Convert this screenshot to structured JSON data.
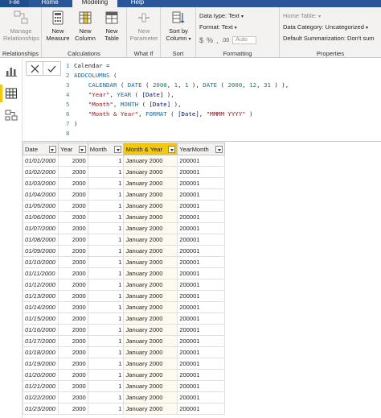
{
  "menu": {
    "tabs": [
      "File",
      "Home",
      "Modeling",
      "Help"
    ]
  },
  "ribbon": {
    "groups": {
      "relationships": {
        "title": "Relationships",
        "buttons": [
          {
            "label": "Manage\nRelationships",
            "icon": "manage-relationships-icon"
          }
        ]
      },
      "calculations": {
        "title": "Calculations",
        "buttons": [
          {
            "label": "New\nMeasure",
            "icon": "calculator-icon"
          },
          {
            "label": "New\nColumn",
            "icon": "new-column-icon"
          },
          {
            "label": "New\nTable",
            "icon": "new-table-icon"
          }
        ]
      },
      "whatif": {
        "title": "What If",
        "buttons": [
          {
            "label": "New\nParameter",
            "icon": "new-parameter-icon"
          }
        ]
      },
      "sort": {
        "title": "Sort",
        "buttons": [
          {
            "label": "Sort by\nColumn",
            "icon": "sort-by-column-icon"
          }
        ]
      },
      "formatting": {
        "title": "Formatting",
        "data_type": "Data type: Text",
        "format": "Format: Text",
        "currency_symbol": "$",
        "percent_symbol": "%",
        "comma_symbol": ",",
        "decimal_symbol": ".00",
        "auto_value": "Auto"
      },
      "properties": {
        "title": "Properties",
        "home_table": "Home Table:",
        "data_category": "Data Category: Uncategorized",
        "default_summarization": "Default Summarization: Don't sum"
      }
    }
  },
  "formula_bar": {
    "lines": [
      {
        "n": "1",
        "tokens": [
          {
            "t": "Calendar ="
          }
        ]
      },
      {
        "n": "2",
        "tokens": [
          {
            "t": "ADDCOLUMNS",
            "c": "kw"
          },
          {
            "t": " ("
          }
        ]
      },
      {
        "n": "3",
        "tokens": [
          {
            "t": "    "
          },
          {
            "t": "CALENDAR",
            "c": "kw"
          },
          {
            "t": " ( "
          },
          {
            "t": "DATE",
            "c": "kw"
          },
          {
            "t": " ( "
          },
          {
            "t": "2000",
            "c": "num"
          },
          {
            "t": ", "
          },
          {
            "t": "1",
            "c": "num"
          },
          {
            "t": ", "
          },
          {
            "t": "1",
            "c": "num"
          },
          {
            "t": " ), "
          },
          {
            "t": "DATE",
            "c": "kw"
          },
          {
            "t": " ( "
          },
          {
            "t": "2000",
            "c": "num"
          },
          {
            "t": ", "
          },
          {
            "t": "12",
            "c": "num"
          },
          {
            "t": ", "
          },
          {
            "t": "31",
            "c": "num"
          },
          {
            "t": " ) ),"
          }
        ]
      },
      {
        "n": "4",
        "tokens": [
          {
            "t": "    "
          },
          {
            "t": "\"Year\"",
            "c": "str"
          },
          {
            "t": ", "
          },
          {
            "t": "YEAR",
            "c": "kw"
          },
          {
            "t": " ( "
          },
          {
            "t": "[Date]",
            "c": "col"
          },
          {
            "t": " ),"
          }
        ]
      },
      {
        "n": "5",
        "tokens": [
          {
            "t": "    "
          },
          {
            "t": "\"Month\"",
            "c": "str"
          },
          {
            "t": ", "
          },
          {
            "t": "MONTH",
            "c": "kw"
          },
          {
            "t": " ( "
          },
          {
            "t": "[Date]",
            "c": "col"
          },
          {
            "t": " ),"
          }
        ]
      },
      {
        "n": "6",
        "tokens": [
          {
            "t": "    "
          },
          {
            "t": "\"Month & Year\"",
            "c": "str"
          },
          {
            "t": ", "
          },
          {
            "t": "FORMAT",
            "c": "kw"
          },
          {
            "t": " ( "
          },
          {
            "t": "[Date]",
            "c": "col"
          },
          {
            "t": ", "
          },
          {
            "t": "\"MMMM YYYY\"",
            "c": "str"
          },
          {
            "t": " )"
          }
        ]
      },
      {
        "n": "7",
        "tokens": [
          {
            "t": ")"
          }
        ]
      },
      {
        "n": "8",
        "tokens": []
      }
    ]
  },
  "table": {
    "columns": [
      "Date",
      "Year",
      "Month",
      "Month & Year",
      "YearMonth"
    ],
    "selected_column": "Month & Year",
    "rows": [
      [
        "01/01/2000",
        "2000",
        "1",
        "January 2000",
        "200001"
      ],
      [
        "01/02/2000",
        "2000",
        "1",
        "January 2000",
        "200001"
      ],
      [
        "01/03/2000",
        "2000",
        "1",
        "January 2000",
        "200001"
      ],
      [
        "01/04/2000",
        "2000",
        "1",
        "January 2000",
        "200001"
      ],
      [
        "01/05/2000",
        "2000",
        "1",
        "January 2000",
        "200001"
      ],
      [
        "01/06/2000",
        "2000",
        "1",
        "January 2000",
        "200001"
      ],
      [
        "01/07/2000",
        "2000",
        "1",
        "January 2000",
        "200001"
      ],
      [
        "01/08/2000",
        "2000",
        "1",
        "January 2000",
        "200001"
      ],
      [
        "01/09/2000",
        "2000",
        "1",
        "January 2000",
        "200001"
      ],
      [
        "01/10/2000",
        "2000",
        "1",
        "January 2000",
        "200001"
      ],
      [
        "01/11/2000",
        "2000",
        "1",
        "January 2000",
        "200001"
      ],
      [
        "01/12/2000",
        "2000",
        "1",
        "January 2000",
        "200001"
      ],
      [
        "01/13/2000",
        "2000",
        "1",
        "January 2000",
        "200001"
      ],
      [
        "01/14/2000",
        "2000",
        "1",
        "January 2000",
        "200001"
      ],
      [
        "01/15/2000",
        "2000",
        "1",
        "January 2000",
        "200001"
      ],
      [
        "01/16/2000",
        "2000",
        "1",
        "January 2000",
        "200001"
      ],
      [
        "01/17/2000",
        "2000",
        "1",
        "January 2000",
        "200001"
      ],
      [
        "01/18/2000",
        "2000",
        "1",
        "January 2000",
        "200001"
      ],
      [
        "01/19/2000",
        "2000",
        "1",
        "January 2000",
        "200001"
      ],
      [
        "01/20/2000",
        "2000",
        "1",
        "January 2000",
        "200001"
      ],
      [
        "01/21/2000",
        "2000",
        "1",
        "January 2000",
        "200001"
      ],
      [
        "01/22/2000",
        "2000",
        "1",
        "January 2000",
        "200001"
      ],
      [
        "01/23/2000",
        "2000",
        "1",
        "January 2000",
        "200001"
      ]
    ]
  },
  "colors": {
    "ribbon_bg": "#f3f2f1",
    "menu_blue": "#2b579a",
    "selected_header": "#f2c811"
  }
}
